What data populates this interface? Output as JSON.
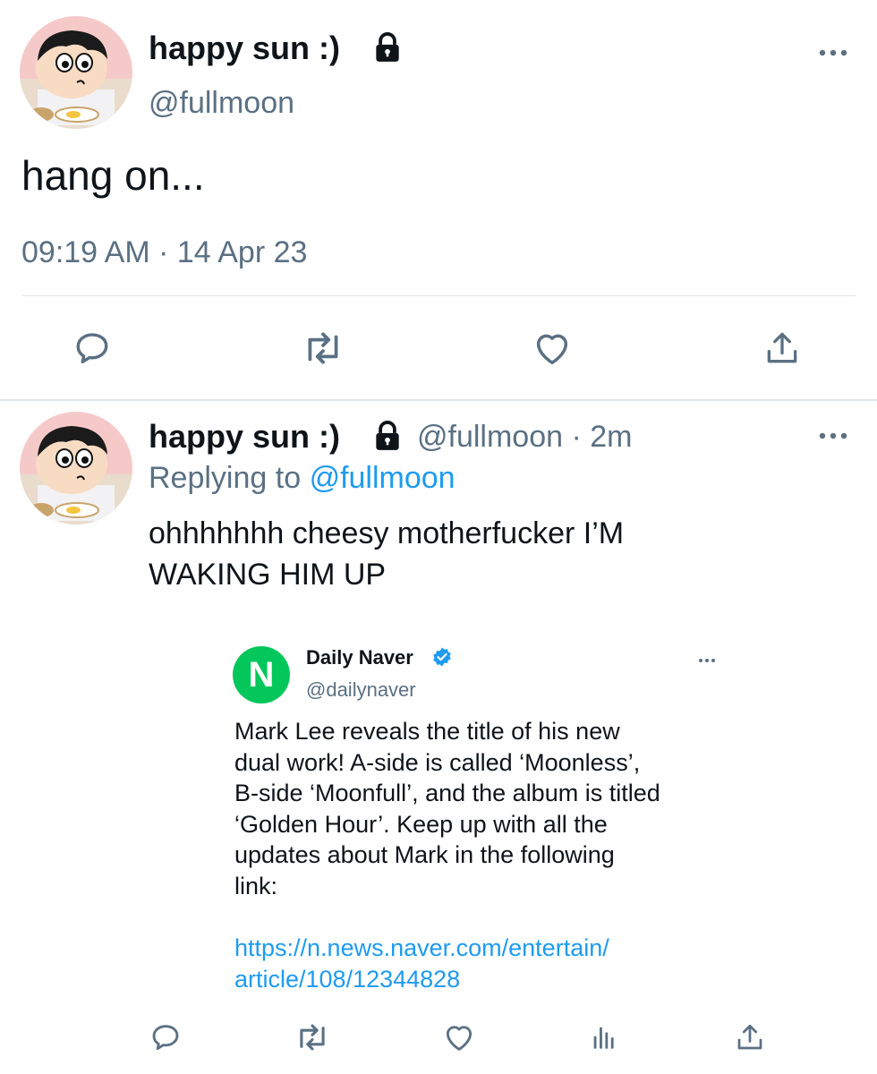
{
  "main_tweet": {
    "display_name": "happy sun :)",
    "handle": "@fullmoon",
    "text": "hang on...",
    "timestamp": "09:19 AM · 14 Apr 23"
  },
  "reply_tweet": {
    "display_name": "happy sun :)",
    "handle_time": "@fullmoon · 2m",
    "replying_prefix": "Replying to",
    "replying_handle": "@fullmoon",
    "text_line1": "ohhhhhhh cheesy motherfucker I’M",
    "text_line2": "WAKING HIM UP"
  },
  "quoted_tweet": {
    "logo_letter": "N",
    "display_name": "Daily Naver",
    "handle": "@dailynaver",
    "lines": [
      "Mark Lee reveals the title of his new",
      "dual work! A-side is called ‘Moonless’,",
      "B-side ‘Moonfull’, and the album is titled",
      "‘Golden Hour’. Keep up with all the",
      "updates about Mark in the following",
      "link:"
    ],
    "link_line1": "https://n.news.naver.com/entertain/",
    "link_line2": "article/108/12344828",
    "brand_color": "#03c75a",
    "verified_color": "#1d9bf0"
  },
  "icons": {
    "lock": "lock-icon",
    "more": "more-icon",
    "reply": "reply-icon",
    "retweet": "retweet-icon",
    "like": "like-icon",
    "share": "share-icon",
    "analytics": "analytics-icon",
    "verified": "verified-badge-icon"
  }
}
